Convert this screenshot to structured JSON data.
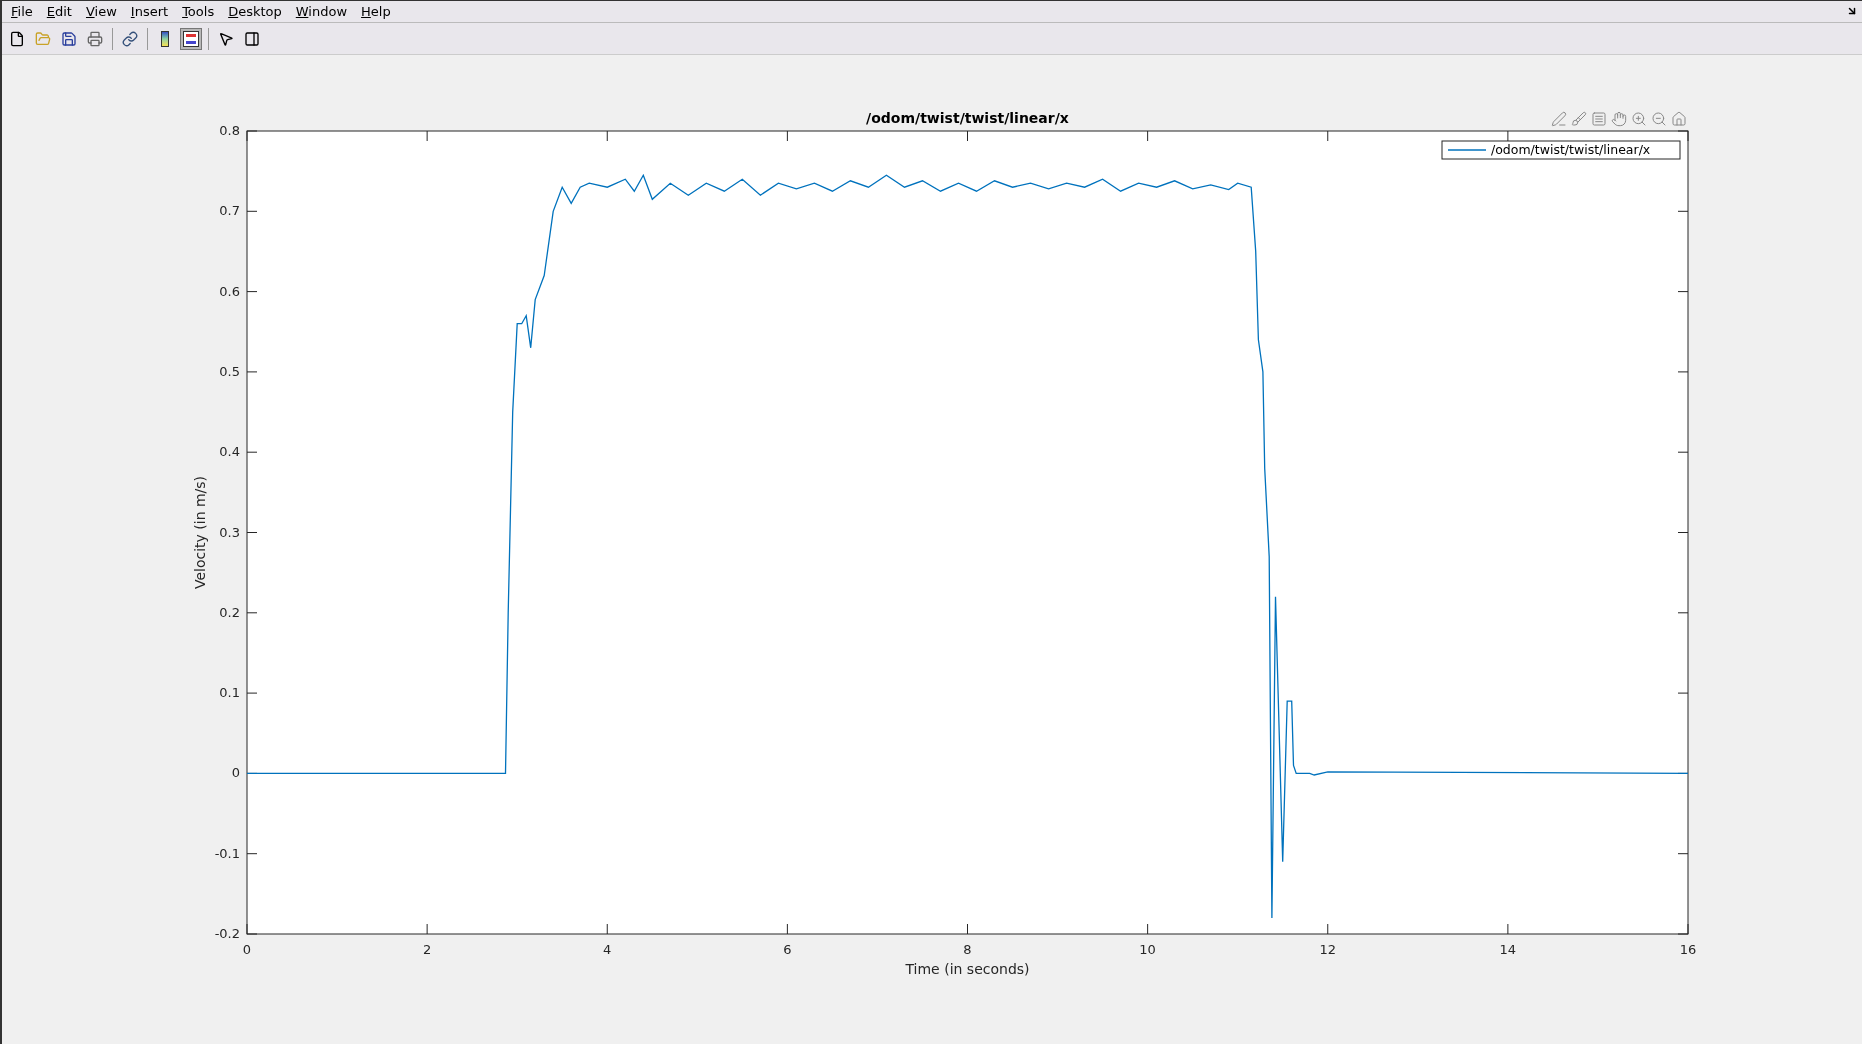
{
  "menu": [
    {
      "label": "File"
    },
    {
      "label": "Edit"
    },
    {
      "label": "View"
    },
    {
      "label": "Insert"
    },
    {
      "label": "Tools"
    },
    {
      "label": "Desktop"
    },
    {
      "label": "Window"
    },
    {
      "label": "Help"
    }
  ],
  "toolbar": [
    {
      "kind": "new",
      "pressed": false
    },
    {
      "kind": "open",
      "pressed": false
    },
    {
      "kind": "save",
      "pressed": false
    },
    {
      "kind": "print",
      "pressed": false
    },
    {
      "kind": "separator"
    },
    {
      "kind": "link",
      "pressed": false
    },
    {
      "kind": "separator"
    },
    {
      "kind": "colorbar",
      "pressed": false
    },
    {
      "kind": "legend",
      "pressed": true
    },
    {
      "kind": "separator"
    },
    {
      "kind": "pointer",
      "pressed": false
    },
    {
      "kind": "browser",
      "pressed": false
    }
  ],
  "axes_toolbar": [
    {
      "kind": "edit"
    },
    {
      "kind": "brush"
    },
    {
      "kind": "datatip"
    },
    {
      "kind": "pan"
    },
    {
      "kind": "zoomin"
    },
    {
      "kind": "zoomout"
    },
    {
      "kind": "home"
    }
  ],
  "chart_data": {
    "type": "line",
    "title": "/odom/twist/twist/linear/x",
    "xlabel": "Time (in seconds)",
    "ylabel": "Velocity (in m/s)",
    "xlim": [
      0,
      16
    ],
    "ylim": [
      -0.2,
      0.8
    ],
    "xticks": [
      0,
      2,
      4,
      6,
      8,
      10,
      12,
      14,
      16
    ],
    "yticks": [
      {
        "value": -0.2,
        "label": "-0.2"
      },
      {
        "value": -0.1,
        "label": "-0.1"
      },
      {
        "value": 0,
        "label": "0"
      },
      {
        "value": 0.1,
        "label": "0.1"
      },
      {
        "value": 0.2,
        "label": "0.2"
      },
      {
        "value": 0.3,
        "label": "0.3"
      },
      {
        "value": 0.4,
        "label": "0.4"
      },
      {
        "value": 0.5,
        "label": "0.5"
      },
      {
        "value": 0.6,
        "label": "0.6"
      },
      {
        "value": 0.7,
        "label": "0.7"
      },
      {
        "value": 0.8,
        "label": "0.8"
      }
    ],
    "x": [
      0,
      2.87,
      2.9,
      2.95,
      3.0,
      3.05,
      3.1,
      3.15,
      3.2,
      3.3,
      3.4,
      3.5,
      3.6,
      3.7,
      3.8,
      4.0,
      4.2,
      4.3,
      4.4,
      4.5,
      4.7,
      4.9,
      5.1,
      5.3,
      5.5,
      5.7,
      5.9,
      6.1,
      6.3,
      6.5,
      6.7,
      6.9,
      7.1,
      7.3,
      7.5,
      7.7,
      7.9,
      8.1,
      8.3,
      8.5,
      8.7,
      8.9,
      9.1,
      9.3,
      9.5,
      9.7,
      9.9,
      10.1,
      10.3,
      10.5,
      10.7,
      10.9,
      11.0,
      11.15,
      11.2,
      11.23,
      11.28,
      11.3,
      11.35,
      11.38,
      11.42,
      11.5,
      11.55,
      11.6,
      11.62,
      11.65,
      11.8,
      11.85,
      12.0,
      16
    ],
    "series": [
      {
        "name": "/odom/twist/twist/linear/x",
        "color": "#0072bd",
        "values": [
          0,
          0,
          0.2,
          0.45,
          0.56,
          0.56,
          0.57,
          0.53,
          0.59,
          0.62,
          0.7,
          0.73,
          0.71,
          0.73,
          0.735,
          0.73,
          0.74,
          0.725,
          0.745,
          0.715,
          0.735,
          0.72,
          0.735,
          0.725,
          0.74,
          0.72,
          0.735,
          0.728,
          0.735,
          0.725,
          0.738,
          0.73,
          0.745,
          0.73,
          0.738,
          0.725,
          0.735,
          0.725,
          0.738,
          0.73,
          0.735,
          0.728,
          0.735,
          0.73,
          0.74,
          0.725,
          0.735,
          0.73,
          0.738,
          0.728,
          0.733,
          0.727,
          0.735,
          0.73,
          0.65,
          0.54,
          0.5,
          0.38,
          0.27,
          -0.18,
          0.22,
          -0.11,
          0.09,
          0.09,
          0.01,
          0,
          0,
          -0.002,
          0.002,
          0
        ]
      }
    ]
  }
}
